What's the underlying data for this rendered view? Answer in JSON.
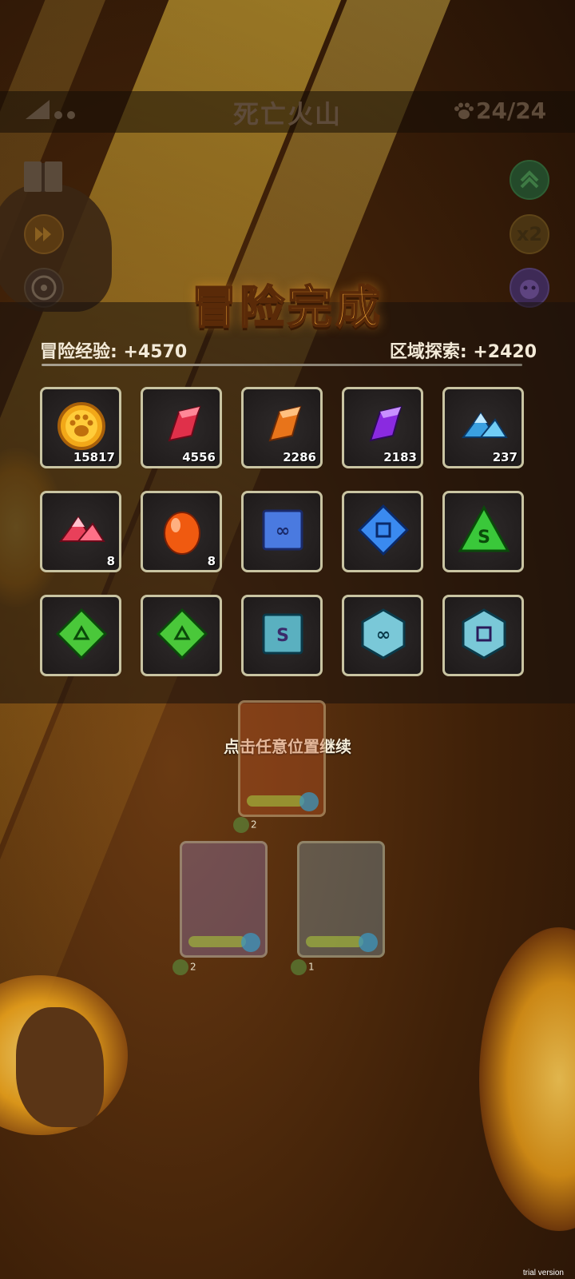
{
  "header": {
    "stage_title": "死亡火山",
    "paw_count": "24/24"
  },
  "side_buttons": {
    "left": [
      "book-icon",
      "fast-forward-icon",
      "fan-icon"
    ],
    "right": [
      "level-up-icon",
      "speed-x2",
      "monster-face-icon"
    ],
    "speed_label": "x2"
  },
  "result": {
    "title": "冒险完成",
    "exp_label": "冒险经验: +4570",
    "explore_label": "区域探索: +2420"
  },
  "rewards": [
    {
      "icon": "gold-paw-coin-icon",
      "count": "15817"
    },
    {
      "icon": "red-crystal-icon",
      "count": "4556"
    },
    {
      "icon": "orange-crystal-icon",
      "count": "2286"
    },
    {
      "icon": "purple-crystal-icon",
      "count": "2183"
    },
    {
      "icon": "blue-gem-pile-icon",
      "count": "237"
    },
    {
      "icon": "red-gem-pile-icon",
      "count": "8"
    },
    {
      "icon": "orange-egg-icon",
      "count": "8"
    },
    {
      "icon": "blue-square-rune-infinity-icon",
      "count": ""
    },
    {
      "icon": "blue-diamond-rune-square-icon",
      "count": ""
    },
    {
      "icon": "green-triangle-rune-s-icon",
      "count": ""
    },
    {
      "icon": "green-diamond-rune-triangle-icon",
      "count": ""
    },
    {
      "icon": "green-diamond-rune-triangle-icon",
      "count": ""
    },
    {
      "icon": "teal-square-rune-s-icon",
      "count": ""
    },
    {
      "icon": "teal-hexagon-rune-infinity-icon",
      "count": ""
    },
    {
      "icon": "teal-hexagon-rune-square-icon",
      "count": ""
    }
  ],
  "continue_text": "点击任意位置继续",
  "team": [
    {
      "name": "viking-warrior-card",
      "level": "2"
    },
    {
      "name": "jellyfish-card",
      "level": "2"
    },
    {
      "name": "crane-card",
      "level": "1"
    }
  ],
  "watermark": "trial version",
  "colors": {
    "title": "#ffb23c",
    "slot_border": "#c9c4a2",
    "background": "#2a1608"
  }
}
